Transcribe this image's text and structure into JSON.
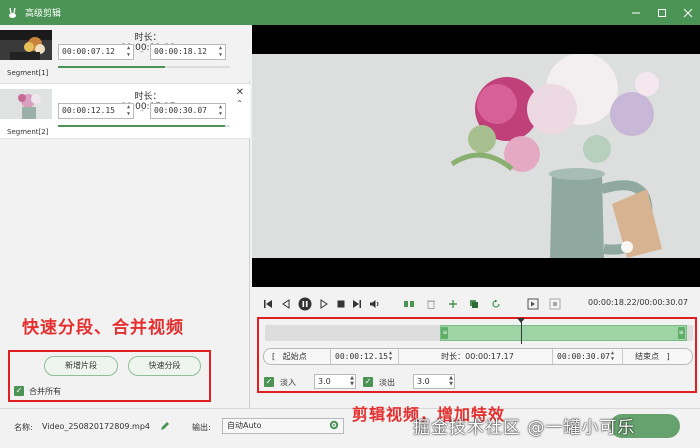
{
  "window": {
    "title": "高级剪辑",
    "icon": "rabbit-logo-icon",
    "minimize": "minimize-icon",
    "restore": "restore-icon",
    "close": "close-icon"
  },
  "segments": [
    {
      "label": "Segment[1]",
      "duration_label": "时长：00:00:11.00",
      "start": "00:00:07.12",
      "end": "00:00:18.12",
      "progress": 0.62
    },
    {
      "label": "Segment[2]",
      "duration_label": "时长：00:00:17.17",
      "start": "00:00:12.15",
      "end": "00:00:30.07",
      "progress": 0.97
    }
  ],
  "left_annotation": "快速分段、合并视频",
  "buttons": {
    "new_segment": "新增片段",
    "quick_split": "快速分段"
  },
  "merge_all": {
    "label": "合并所有",
    "checked": true
  },
  "player": {
    "time_readout": "00:00:18.22/00:00:30.07",
    "controls": [
      "skip-start-icon",
      "step-back-icon",
      "pause-icon",
      "step-forward-icon",
      "stop-icon",
      "skip-end-icon",
      "volume-icon",
      "split-icon",
      "delete-icon",
      "add-icon",
      "copy-icon",
      "reset-icon",
      "mark-in-icon",
      "mark-out-icon"
    ]
  },
  "timeline": {
    "selection_start": 0.41,
    "selection_end": 0.985,
    "playhead": 0.598
  },
  "edit": {
    "start_btn": "起始点",
    "start_value": "00:00:12.15",
    "duration": "时长：00:00:17.17",
    "end_value": "00:00:30.07",
    "end_btn": "结束点",
    "fade_in_label": "淡入",
    "fade_in_value": "3.0",
    "fade_out_label": "淡出",
    "fade_out_value": "3.0"
  },
  "right_annotation": "剪辑视频，增加特效",
  "bottom": {
    "name_label": "名称:",
    "filename": "Video_250820172809.mp4",
    "output_label": "输出:",
    "output_value": "自动Auto"
  },
  "watermark": "掘金技术社区 @一罐小可乐"
}
